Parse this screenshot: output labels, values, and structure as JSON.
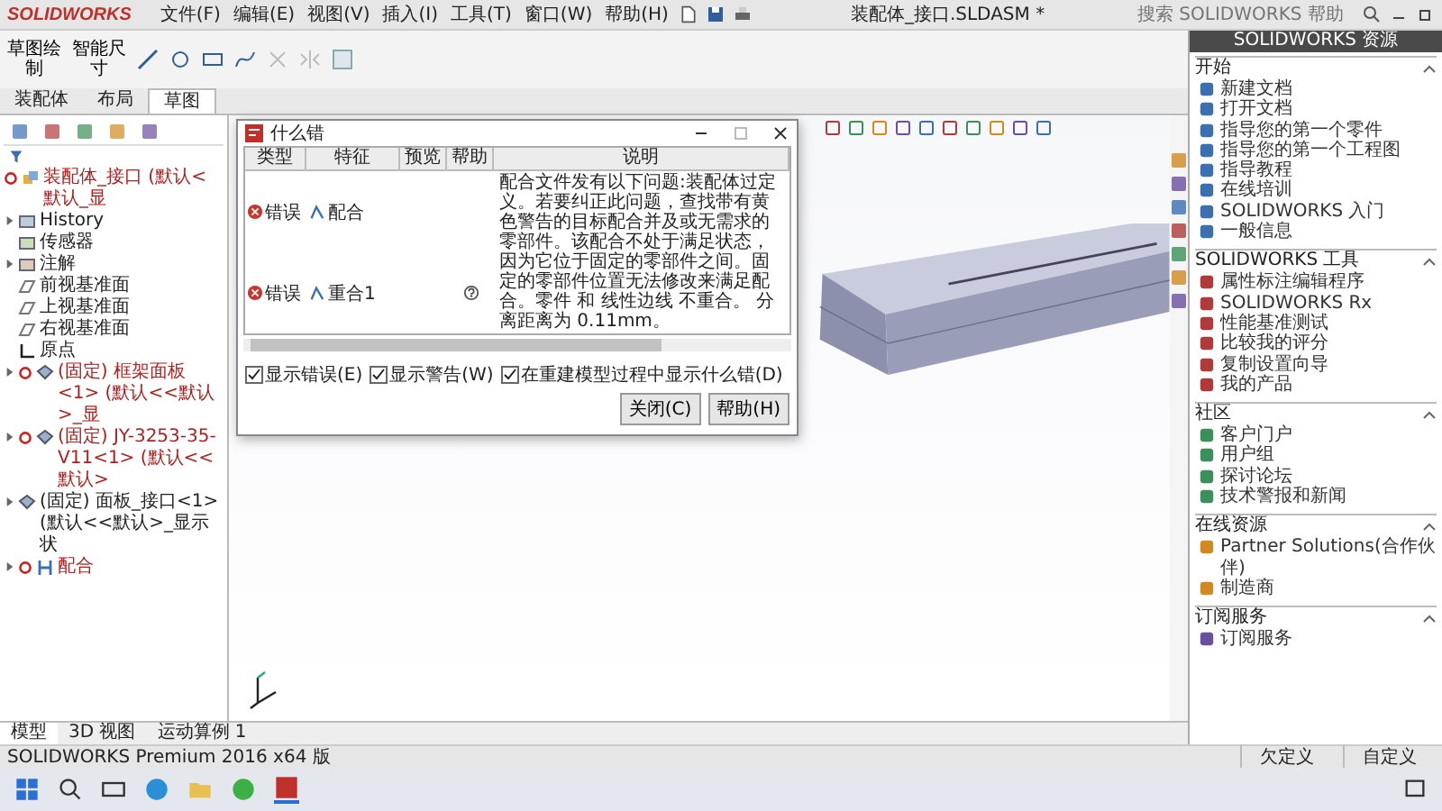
{
  "app": {
    "logo": "SOLIDWORKS",
    "menus": [
      "文件(F)",
      "编辑(E)",
      "视图(V)",
      "插入(I)",
      "工具(T)",
      "窗口(W)",
      "帮助(H)"
    ],
    "title": "装配体_接口.SLDASM *",
    "search": {
      "placeholder": "搜索 SOLIDWORKS 帮助"
    }
  },
  "command_manager": {
    "tools": [
      "草图绘制",
      "智能尺寸"
    ],
    "tabs": [
      {
        "label": "装配体",
        "selected": false
      },
      {
        "label": "布局",
        "selected": false
      },
      {
        "label": "草图",
        "selected": true
      }
    ]
  },
  "feature_tree": {
    "root": {
      "label": "装配体_接口 (默认<默认_显",
      "error": true
    },
    "items": [
      {
        "label": "History",
        "kind": "history",
        "error": false,
        "expandable": true
      },
      {
        "label": "传感器",
        "kind": "sensor",
        "error": false,
        "expandable": false
      },
      {
        "label": "注解",
        "kind": "annotation",
        "error": false,
        "expandable": true
      },
      {
        "label": "前视基准面",
        "kind": "plane",
        "error": false,
        "expandable": false
      },
      {
        "label": "上视基准面",
        "kind": "plane",
        "error": false,
        "expandable": false
      },
      {
        "label": "右视基准面",
        "kind": "plane",
        "error": false,
        "expandable": false
      },
      {
        "label": "原点",
        "kind": "origin",
        "error": false,
        "expandable": false
      },
      {
        "label": "(固定) 框架面板<1> (默认<<默认>_显",
        "kind": "part",
        "error": true,
        "expandable": true
      },
      {
        "label": "(固定) JY-3253-35-V11<1> (默认<<默认>",
        "kind": "part",
        "error": true,
        "expandable": true
      },
      {
        "label": "(固定) 面板_接口<1> (默认<<默认>_显示状",
        "kind": "part",
        "error": false,
        "expandable": true
      },
      {
        "label": "配合",
        "kind": "mates",
        "error": true,
        "expandable": true
      }
    ]
  },
  "dialog": {
    "title": "什么错",
    "columns": [
      "类型",
      "特征",
      "预览",
      "帮助",
      "说明"
    ],
    "rows": [
      {
        "type": "错误",
        "feature": "配合",
        "help": false
      },
      {
        "type": "错误",
        "feature": "重合1",
        "help": true
      }
    ],
    "description": "配合文件发有以下问题:装配体过定义。若要纠正此问题，查找带有黄色警告的目标配合并及或无需求的零部件。该配合不处于满足状态，因为它位于固定的零部件之间。固定的零部件位置无法修改来满足配合。零件 和 线性边线 不重合。 分离距离为 0.11mm。",
    "options": [
      {
        "label": "显示错误(E)",
        "checked": true
      },
      {
        "label": "显示警告(W)",
        "checked": true
      },
      {
        "label": "在重建模型过程中显示什么错(D)",
        "checked": true
      }
    ],
    "buttons": [
      "关闭(C)",
      "帮助(H)"
    ]
  },
  "resources": {
    "title": "SOLIDWORKS 资源",
    "sections": [
      {
        "title": "开始",
        "items": [
          "新建文档",
          "打开文档",
          "指导您的第一个零件",
          "指导您的第一个工程图",
          "指导教程",
          "在线培训",
          "SOLIDWORKS 入门",
          "一般信息"
        ]
      },
      {
        "title": "SOLIDWORKS 工具",
        "items": [
          "属性标注编辑程序",
          "SOLIDWORKS Rx",
          "性能基准测试",
          "比较我的评分",
          "复制设置向导",
          "我的产品"
        ]
      },
      {
        "title": "社区",
        "items": [
          "客户门户",
          "用户组",
          "探讨论坛",
          "技术警报和新闻"
        ]
      },
      {
        "title": "在线资源",
        "items": [
          "Partner Solutions(合作伙伴)",
          "制造商"
        ]
      },
      {
        "title": "订阅服务",
        "items": [
          "订阅服务"
        ]
      }
    ]
  },
  "bottom_tabs": [
    {
      "label": "模型",
      "selected": true
    },
    {
      "label": "3D 视图",
      "selected": false
    },
    {
      "label": "运动算例 1",
      "selected": false
    }
  ],
  "status_bar": {
    "product": "SOLIDWORKS Premium 2016 x64 版",
    "state": "欠定义",
    "units": "自定义"
  }
}
